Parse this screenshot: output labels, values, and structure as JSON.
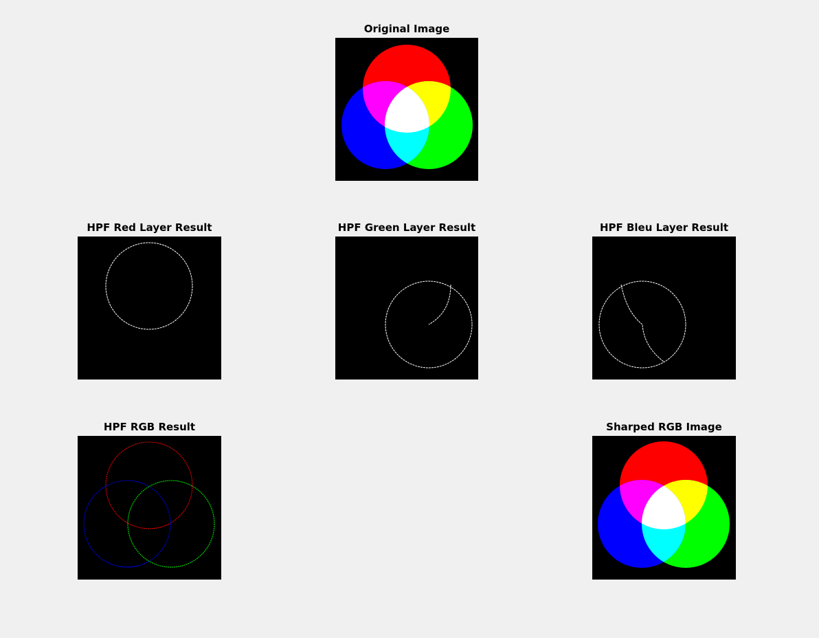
{
  "figure": {
    "background": "#f0f0f0",
    "panels": [
      {
        "id": "original",
        "title": "Original Image"
      },
      {
        "id": "hpf_red",
        "title": "HPF Red Layer Result"
      },
      {
        "id": "hpf_green",
        "title": "HPF Green Layer Result"
      },
      {
        "id": "hpf_blue",
        "title": "HPF Bleu Layer Result"
      },
      {
        "id": "hpf_rgb",
        "title": "HPF RGB Result"
      },
      {
        "id": "sharped",
        "title": "Sharped RGB Image"
      }
    ]
  },
  "colors": {
    "red": "#ff0000",
    "green": "#00ff00",
    "blue": "#0000ff",
    "yellow": "#ffff00",
    "magenta": "#ff00ff",
    "cyan": "#00ffff",
    "white": "#ffffff",
    "black": "#000000"
  }
}
